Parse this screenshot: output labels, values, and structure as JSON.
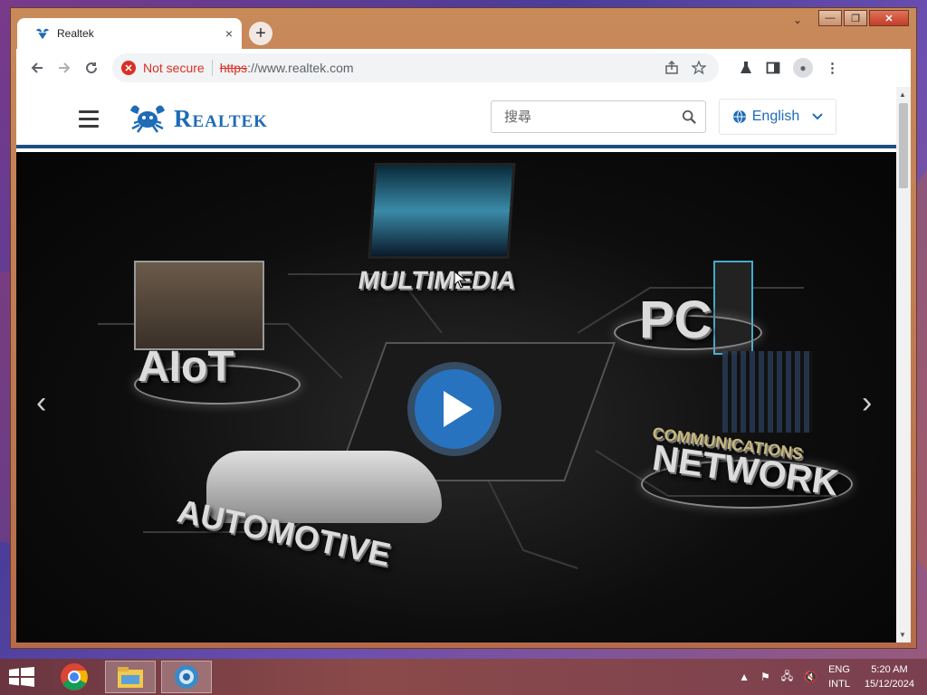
{
  "browser": {
    "tab_title": "Realtek",
    "tab_close": "×",
    "new_tab": "+",
    "security_label": "Not secure",
    "url_protocol": "https",
    "url_rest": "://www.realtek.com",
    "window_controls": {
      "minimize": "—",
      "maximize": "❐",
      "close": "✕"
    }
  },
  "site": {
    "logo_text": "Realtek",
    "search_placeholder": "搜尋",
    "language": "English"
  },
  "hero": {
    "labels": {
      "multimedia": "MULTIMEDIA",
      "pc": "PC",
      "aiot": "AIoT",
      "automotive": "AUTOMOTIVE",
      "communications": "COMMUNICATIONS",
      "network": "NETWORK"
    },
    "prev": "‹",
    "next": "›",
    "accent_color": "#1e6bb8"
  },
  "taskbar": {
    "lang_line1": "ENG",
    "lang_line2": "INTL",
    "time": "5:20 AM",
    "date": "15/12/2024"
  }
}
